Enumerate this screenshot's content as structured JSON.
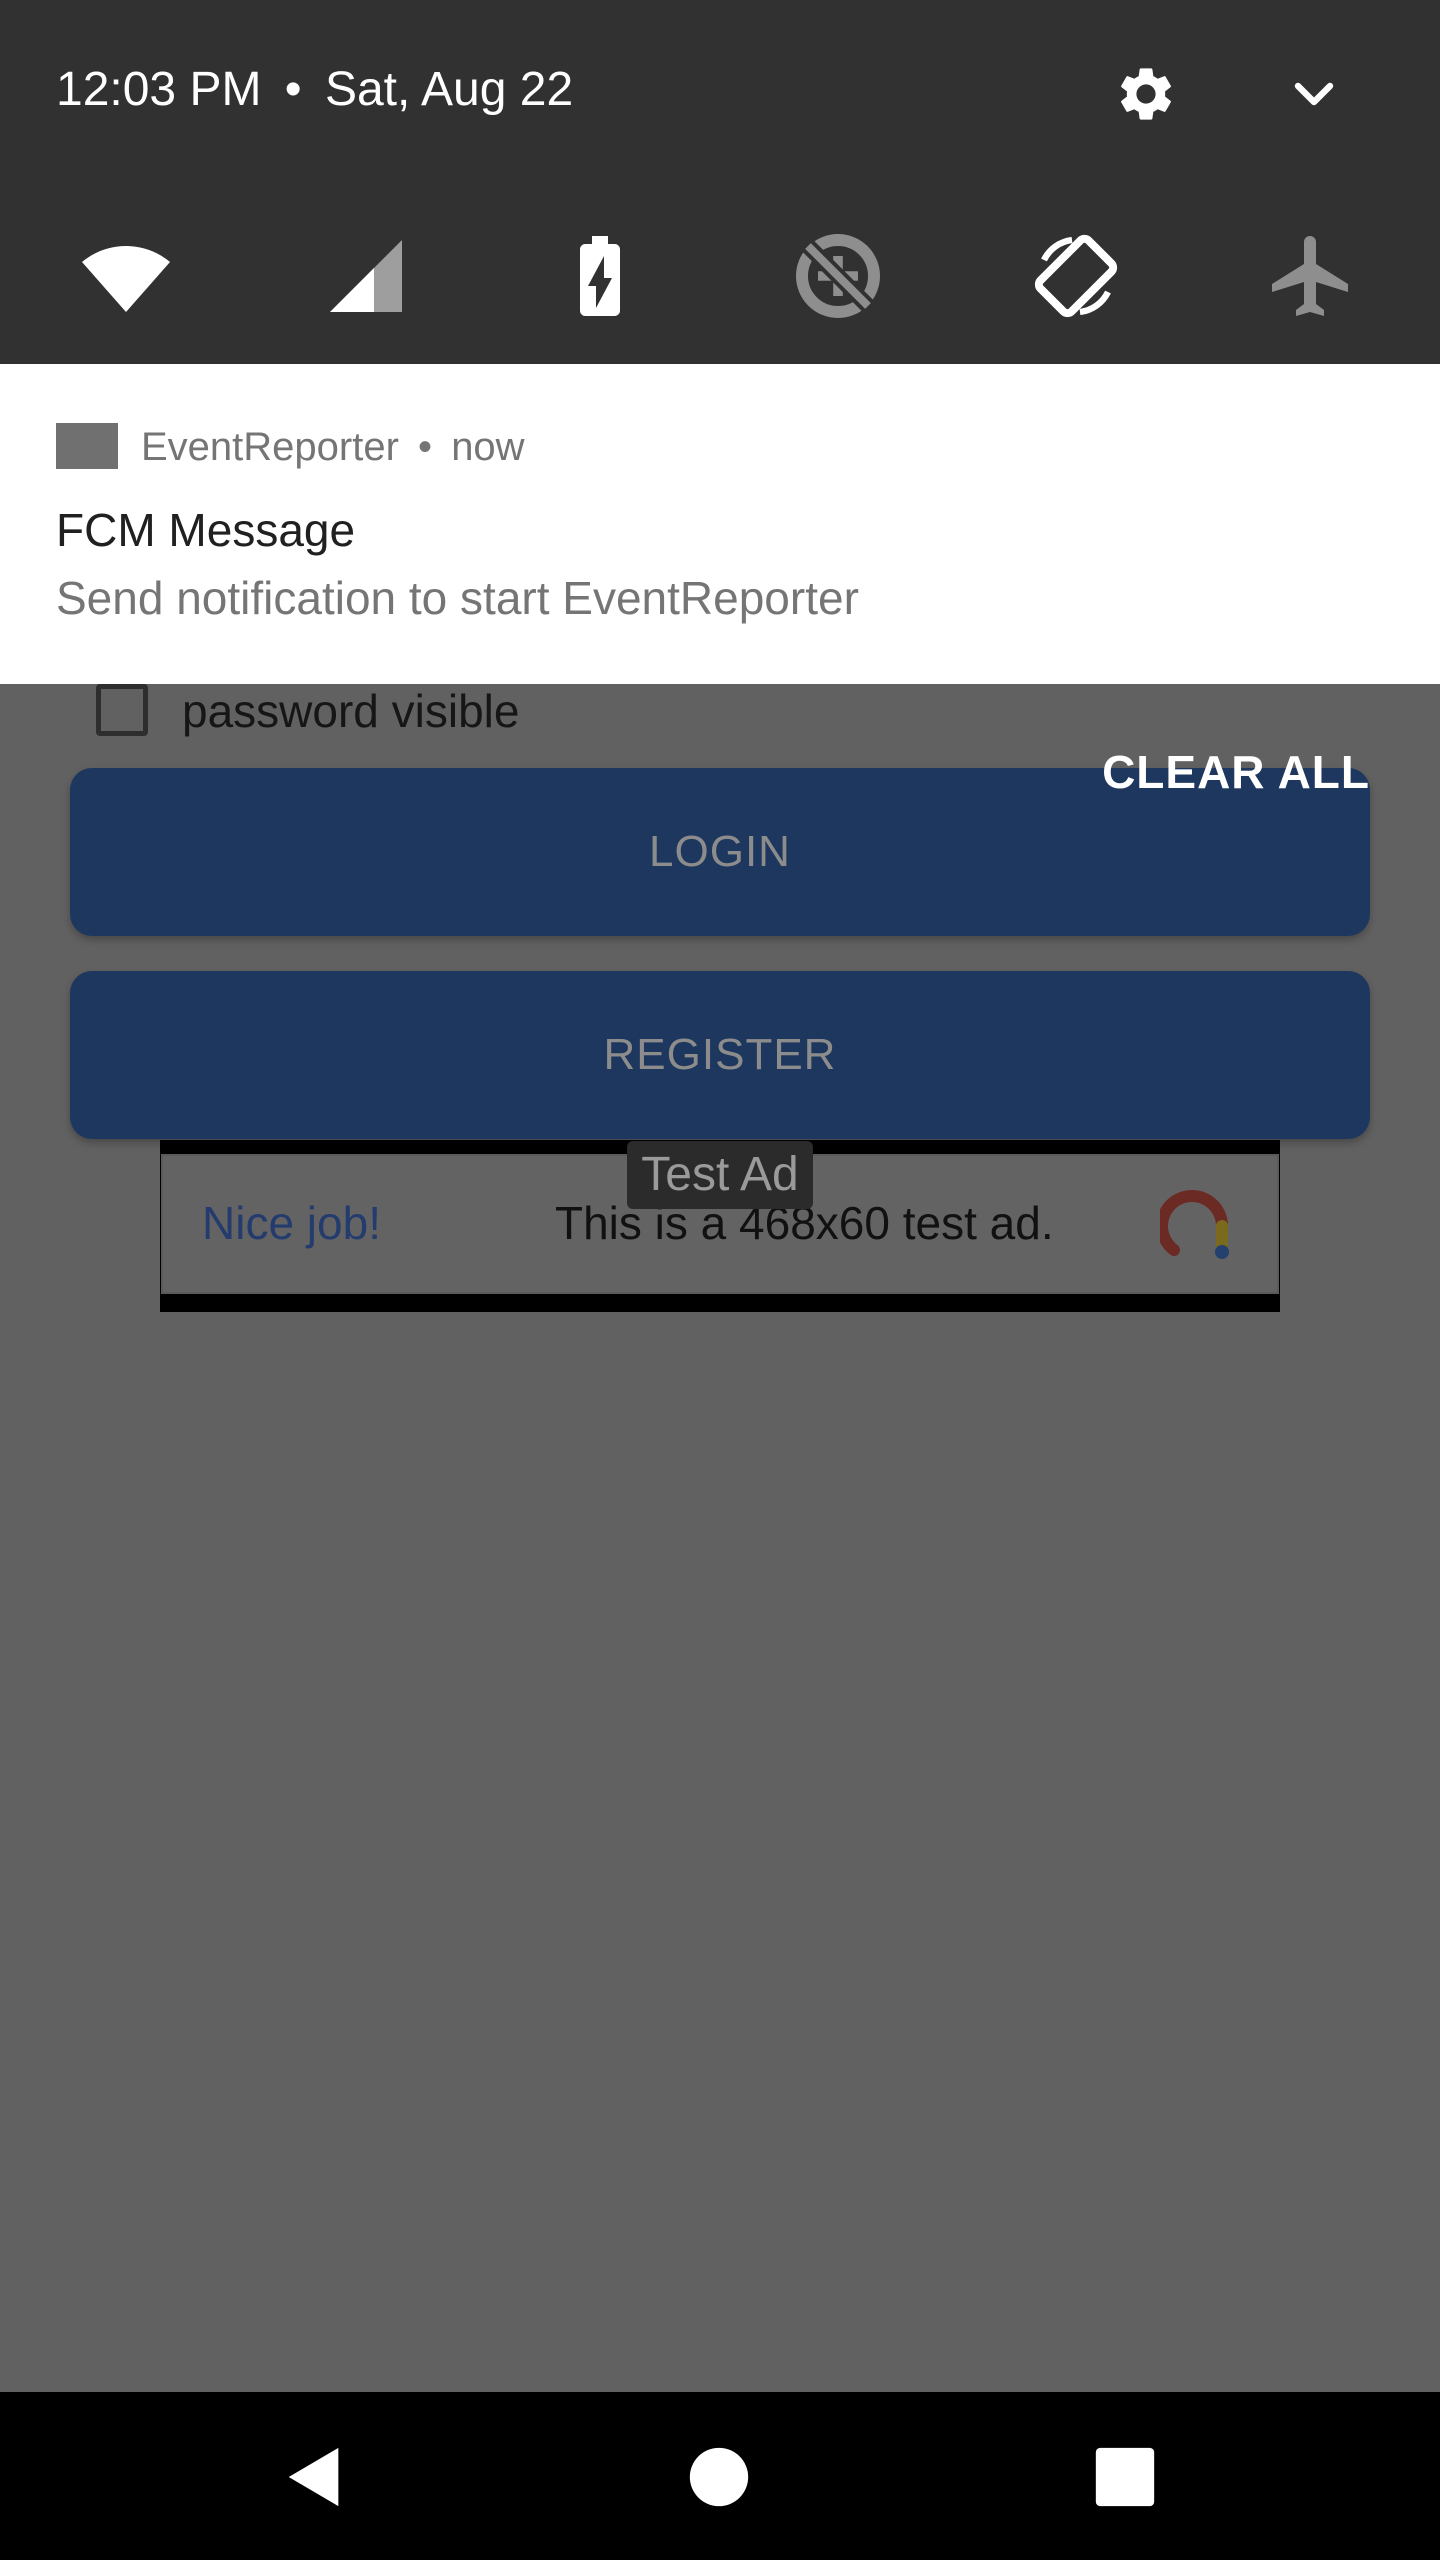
{
  "status_header": {
    "time": "12:03 PM",
    "separator": "•",
    "date": "Sat, Aug 22",
    "icons": [
      "gear-icon",
      "chevron-down-icon"
    ]
  },
  "quick_settings": {
    "tiles": [
      "wifi-icon",
      "cellular-signal-icon",
      "battery-charging-icon",
      "data-saver-off-icon",
      "auto-rotate-icon",
      "airplane-mode-icon"
    ]
  },
  "notification": {
    "app_name": "EventReporter",
    "separator": "•",
    "time": "now",
    "title": "FCM Message",
    "body": "Send notification to start EventReporter"
  },
  "clear_all_label": "CLEAR ALL",
  "app": {
    "checkbox_label": "password visible",
    "login_label": "LOGIN",
    "register_label": "REGISTER",
    "ad": {
      "badge": "Test Ad",
      "headline": "Nice job!",
      "text": "This is a 468x60 test ad."
    }
  },
  "nav_bar": {
    "icons": [
      "back-icon",
      "home-icon",
      "recents-icon"
    ]
  },
  "colors": {
    "scrim_background": "#616161",
    "shade_dark": "#313131",
    "button_blue": "#1d375e",
    "ad_link_blue": "#243b6e"
  }
}
